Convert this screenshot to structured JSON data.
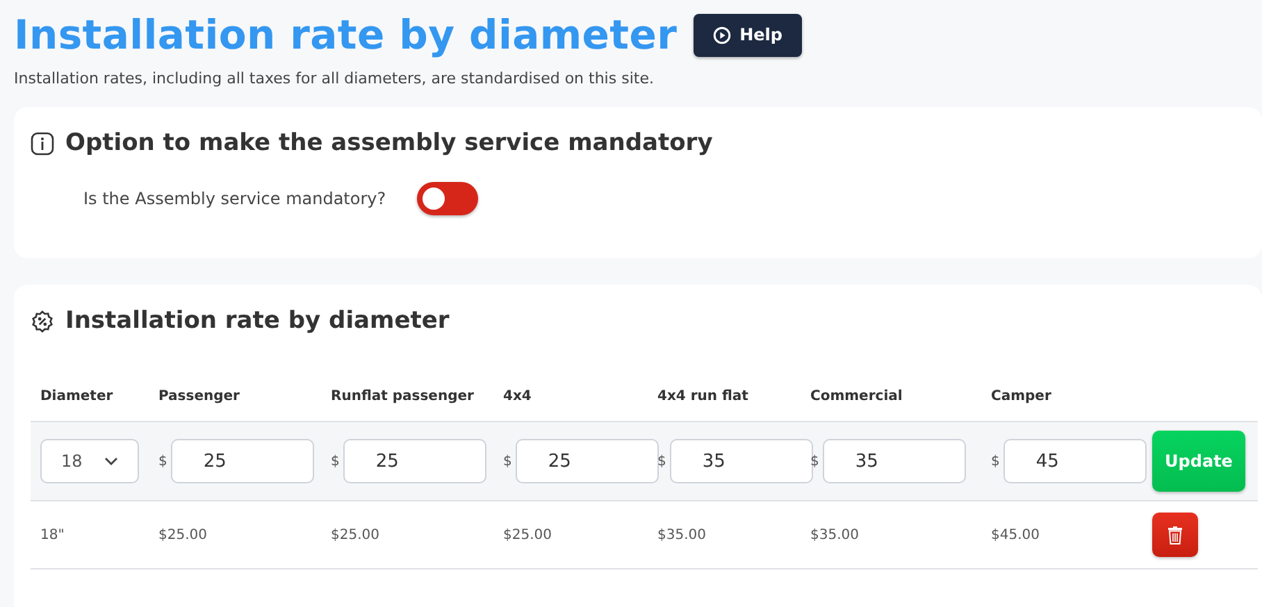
{
  "header": {
    "title": "Installation rate by diameter",
    "help_button": "Help",
    "subtitle": "Installation rates, including all taxes for all diameters, are standardised on this site."
  },
  "assembly_card": {
    "title": "Option to make the assembly service mandatory",
    "toggle_label": "Is the Assembly service mandatory?",
    "on": false
  },
  "rates_card": {
    "title": "Installation rate by diameter",
    "columns": [
      "Diameter",
      "Passenger",
      "Runflat passenger",
      "4x4",
      "4x4 run flat",
      "Commercial",
      "Camper"
    ],
    "edit_row": {
      "diameter": "18",
      "currency": "$",
      "values": [
        "25",
        "25",
        "25",
        "35",
        "35",
        "45"
      ],
      "button": "Update"
    },
    "rows": [
      {
        "cells": [
          "18\"",
          "$25.00",
          "$25.00",
          "$25.00",
          "$35.00",
          "$35.00",
          "$45.00"
        ]
      }
    ]
  }
}
